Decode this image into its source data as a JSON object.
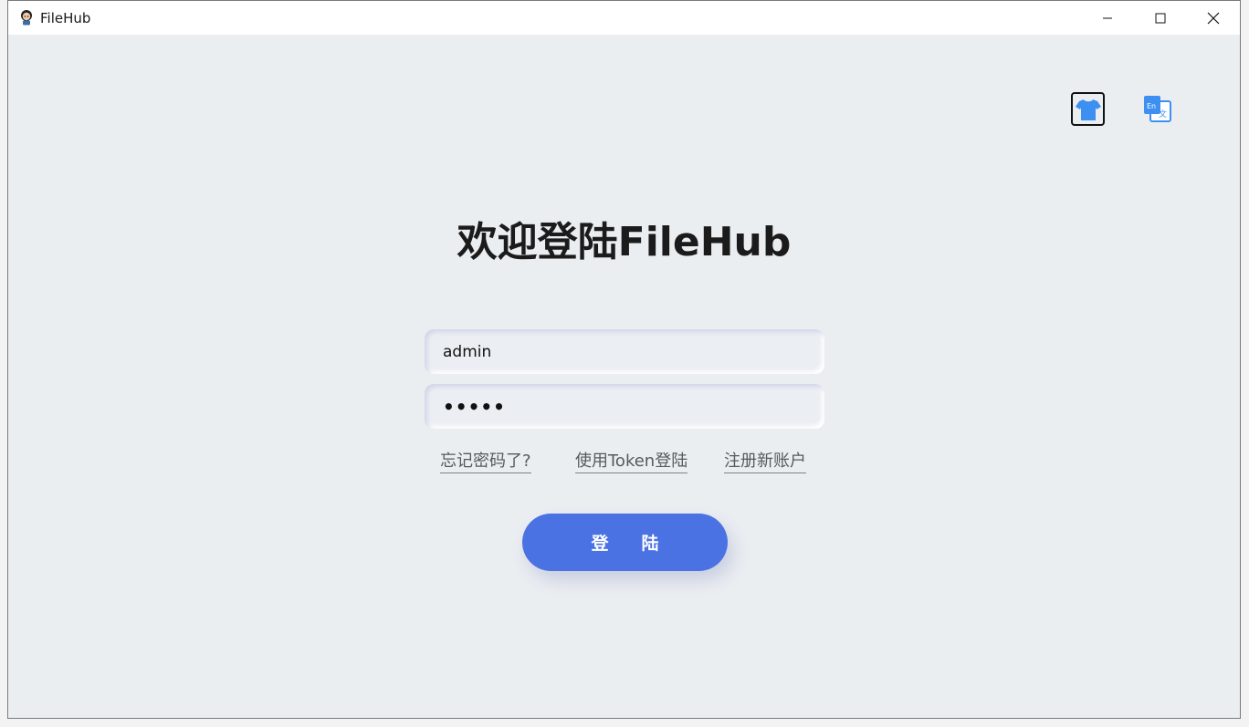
{
  "window": {
    "title": "FileHub"
  },
  "header": {
    "welcome_title": "欢迎登陆FileHub"
  },
  "form": {
    "username_value": "admin",
    "password_value": "•••••"
  },
  "links": {
    "forgot_password": "忘记密码了?",
    "token_login": "使用Token登陆",
    "register": "注册新账户"
  },
  "actions": {
    "login_label": "登陆"
  },
  "icons": {
    "theme": "tshirt-icon",
    "language": "translate-icon"
  },
  "colors": {
    "accent": "#4b72e3",
    "icon_blue": "#3d8ff2"
  }
}
